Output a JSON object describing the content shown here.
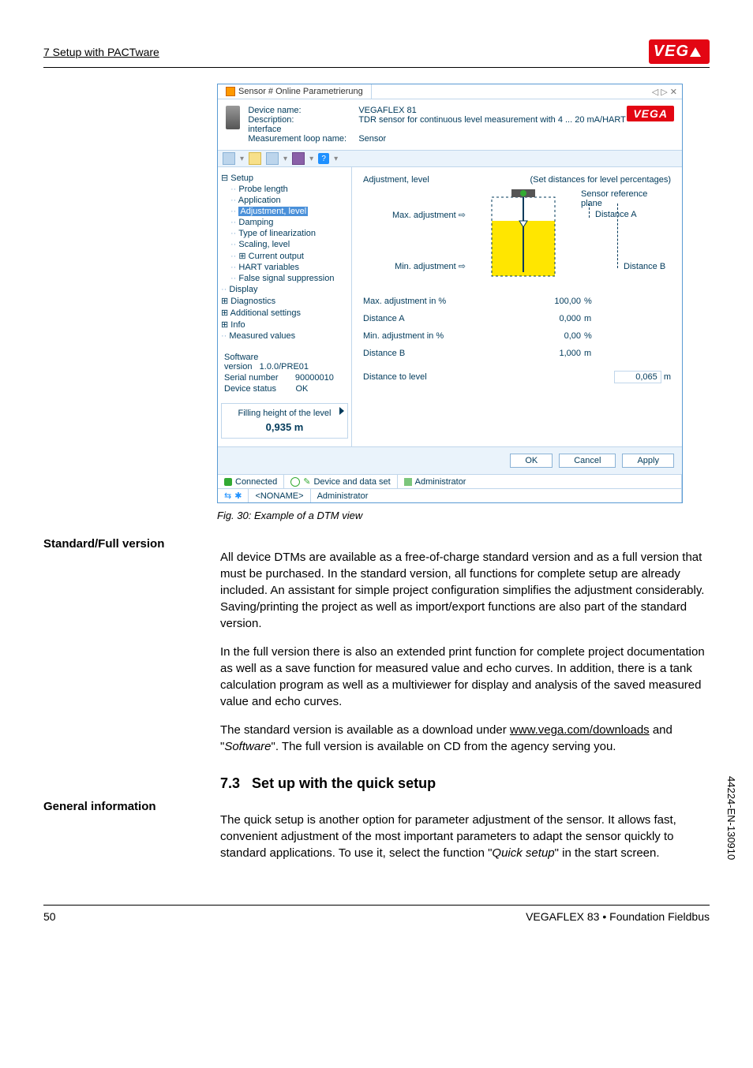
{
  "header": {
    "title": "7 Setup with PACTware"
  },
  "dtm": {
    "tab_title": "Sensor # Online Parametrierung",
    "device": {
      "name_label": "Device name:",
      "name_value": "VEGAFLEX 81",
      "desc_label": "Description:",
      "desc_value": "TDR sensor for continuous level measurement with 4 ... 20 mA/HART interface",
      "loop_label": "Measurement loop name:",
      "loop_value": "Sensor"
    },
    "tree": {
      "root": "Setup",
      "items": [
        "Probe length",
        "Application",
        "Adjustment, level",
        "Damping",
        "Type of linearization",
        "Scaling, level",
        "Current output",
        "HART variables",
        "False signal suppression"
      ],
      "after": [
        "Display",
        "Diagnostics",
        "Additional settings",
        "Info"
      ],
      "measured": "Measured values"
    },
    "meas": {
      "sw_label": "Software version",
      "sw_value": "1.0.0/PRE01",
      "sn_label": "Serial number",
      "sn_value": "90000010",
      "st_label": "Device status",
      "st_value": "OK"
    },
    "fill": {
      "label": "Filling height of the level",
      "value": "0,935 m"
    },
    "main": {
      "title": "Adjustment, level",
      "hint": "(Set distances for level percentages)",
      "srp": "Sensor reference plane",
      "max_label": "Max. adjustment",
      "min_label": "Min. adjustment",
      "distA": "Distance A",
      "distB": "Distance B"
    },
    "readouts": {
      "max_pct_label": "Max. adjustment in %",
      "max_pct_value": "100,00",
      "distA_label": "Distance A",
      "distA_value": "0,000",
      "min_pct_label": "Min. adjustment in %",
      "min_pct_value": "0,00",
      "distB_label": "Distance B",
      "distB_value": "1,000",
      "dist_level_label": "Distance to level",
      "dist_level_value": "0,065",
      "unit_pct": "%",
      "unit_m": "m"
    },
    "buttons": {
      "ok": "OK",
      "cancel": "Cancel",
      "apply": "Apply"
    },
    "status": {
      "connected": "Connected",
      "dataset": "Device and data set",
      "admin": "Administrator",
      "noname": "<NONAME>"
    }
  },
  "caption": "Fig. 30: Example of a DTM view",
  "sections": {
    "std_label": "Standard/Full version",
    "std_p1": "All device DTMs are available as a free-of-charge standard version and as a full version that must be purchased. In the standard version, all functions for complete setup are already included. An assistant for simple project configuration simplifies the adjustment considerably. Saving/printing the project as well as import/export functions are also part of the standard version.",
    "std_p2": "In the full version there is also an extended print function for complete project documentation as well as a save function for measured value and echo curves. In addition, there is a tank calculation program as well as a multiviewer for display and analysis of the saved measured value and echo curves.",
    "std_p3a": "The standard version is available as a download under ",
    "std_link": "www.vega.com/downloads",
    "std_p3b": " and \"",
    "std_italic": "Software",
    "std_p3c": "\". The full version is available on CD from the agency serving you.",
    "h2_num": "7.3",
    "h2_title": "Set up with the quick setup",
    "gen_label": "General information",
    "gen_p1a": "The quick setup is another option for parameter adjustment of the sensor. It allows fast, convenient adjustment of the most important parameters to adapt the sensor quickly to standard applications. To use it, select the function \"",
    "gen_italic": "Quick setup",
    "gen_p1b": "\" in the start screen."
  },
  "footer": {
    "page": "50",
    "product": "VEGAFLEX 83 • Foundation Fieldbus",
    "side_code": "44224-EN-130910"
  }
}
